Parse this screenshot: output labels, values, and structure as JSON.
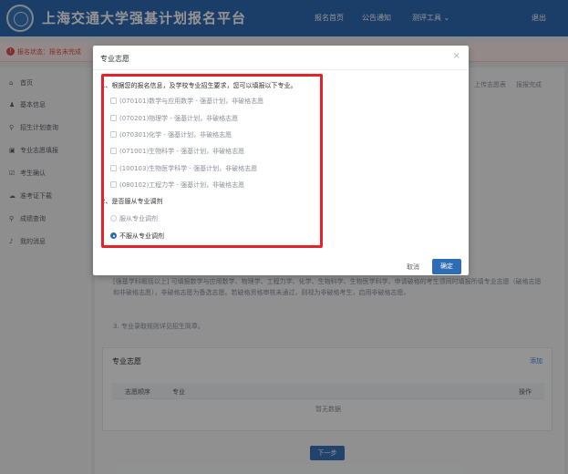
{
  "header": {
    "site_title": "上海交通大学强基计划报名平台",
    "nav": [
      "报名首页",
      "公告通知",
      "测评工具 ⌄",
      "退出"
    ]
  },
  "status": {
    "text": "报名状态：报名未完成"
  },
  "sidebar": {
    "items": [
      {
        "label": "首页",
        "icon": "home-icon"
      },
      {
        "label": "基本信息",
        "icon": "user-icon"
      },
      {
        "label": "招生计划查询",
        "icon": "search-icon"
      },
      {
        "label": "专业志愿填报",
        "icon": "list-icon"
      },
      {
        "label": "考生确认",
        "icon": "check-icon"
      },
      {
        "label": "准考证下载",
        "icon": "download-icon"
      },
      {
        "label": "成绩查询",
        "icon": "search-icon"
      },
      {
        "label": "我的消息",
        "icon": "bell-icon"
      }
    ]
  },
  "steps": {
    "step1": "上传志愿表",
    "step2": "报报完成"
  },
  "main": {
    "notice_text": "[强基学科概括以上] 可填报数学与应用数学、物理学、工程力学、化学、生物科学、生物医学科学。申请破格的考生须同时填报所填专业志愿（破格志愿和非破格志愿），非破格志愿为备选志愿。若破格资格审核未通过，则视为非破格考生，启用非破格志愿。",
    "notice_3": "3. 专业录取规则详见招生简章。",
    "panel_title": "专业志愿",
    "panel_add": "添加",
    "table_headers": [
      "志愿顺序",
      "专业",
      "操作"
    ],
    "empty_text": "暂无数据",
    "next_button": "下一步"
  },
  "dialog": {
    "title": "专业志愿",
    "close": "×",
    "question1": "1、根据您的报名信息，及学校专业招生要求，您可以填报以下专业。",
    "majors": [
      "(070101)数学与应用数学 - 强基计划，非破格志愿",
      "(070201)物理学 - 强基计划，非破格志愿",
      "(070301)化学 - 强基计划，非破格志愿",
      "(071001)生物科学 - 强基计划，非破格志愿",
      "(100103)生物医学科学 - 强基计划，非破格志愿",
      "(080102)工程力学 - 强基计划，非破格志愿"
    ],
    "question2": "2、是否服从专业调剂",
    "adjust_options": [
      "服从专业调剂",
      "不服从专业调剂"
    ],
    "selected_adjust": 1,
    "cancel": "取消",
    "confirm": "确定"
  },
  "colors": {
    "primary": "#2e6cb3",
    "highlight": "#e5212b",
    "status": "#e25050"
  }
}
